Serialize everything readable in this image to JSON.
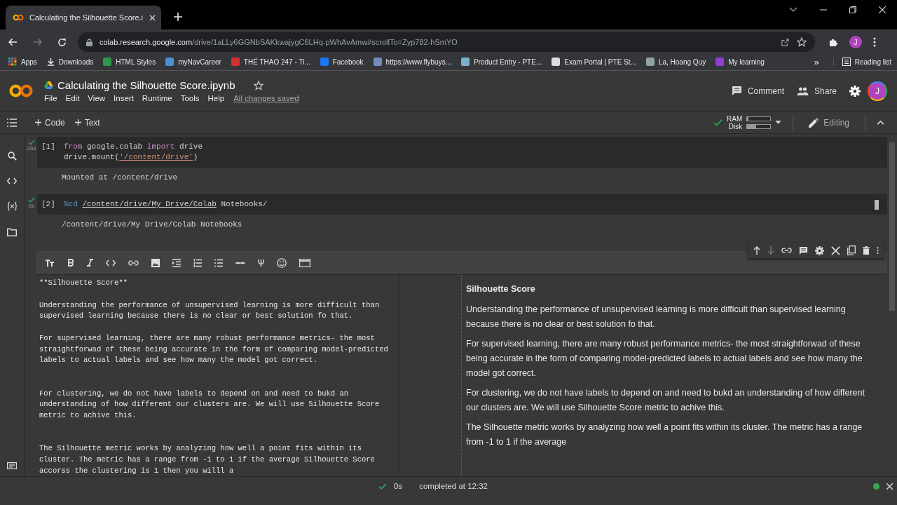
{
  "browser": {
    "tabs": [
      {
        "title": "Calculating the Silhouette Score.i",
        "selected": true
      }
    ],
    "url": {
      "host": "colab.research.google.com",
      "path": "/drive/1aLLy6GGNbSAKkwajygC6LHq-pWhAvAmw#scrollTo=Zyp782-hSmYO"
    },
    "profile_initial": "J",
    "bookmarks": [
      {
        "label": "Apps",
        "kind": "apps"
      },
      {
        "label": "Downloads",
        "kind": "download"
      },
      {
        "label": "HTML Styles",
        "kind": "site",
        "color": "#2e9b4a"
      },
      {
        "label": "myNavCareer",
        "kind": "site",
        "color": "#4a8fd6"
      },
      {
        "label": "THỂ THAO 247 - Ti...",
        "kind": "site",
        "color": "#d32f2f"
      },
      {
        "label": "Facebook",
        "kind": "site",
        "color": "#1877f2"
      },
      {
        "label": "https://www.flybuys...",
        "kind": "site",
        "color": "#6f8fb5"
      },
      {
        "label": "Product Entry - PTE...",
        "kind": "site",
        "color": "#7ab3c9"
      },
      {
        "label": "Exam Portal | PTE St...",
        "kind": "site",
        "color": "#dddddd"
      },
      {
        "label": "La, Hoang Quy",
        "kind": "site",
        "color": "#8fa3a0"
      },
      {
        "label": "My learning",
        "kind": "site",
        "color": "#8e3fd0"
      }
    ],
    "bookmarks_overflow": "»",
    "reading_list": "Reading list"
  },
  "notebook": {
    "title": "Calculating the Silhouette Score.ipynb",
    "starred": false,
    "menu": [
      "File",
      "Edit",
      "View",
      "Insert",
      "Runtime",
      "Tools",
      "Help"
    ],
    "save_status": "All changes saved",
    "comment": "Comment",
    "share": "Share",
    "user_initial": "J",
    "add_buttons": [
      "Code",
      "Text"
    ],
    "connected": true,
    "resources": [
      {
        "label": "RAM",
        "level": 0.05
      },
      {
        "label": "Disk",
        "level": 0.4
      }
    ],
    "mode": "Editing"
  },
  "cells": [
    {
      "kind": "code",
      "count": "[1]",
      "done": true,
      "time": "26s",
      "lines": [
        [
          {
            "kind": "keyword",
            "text": "from"
          },
          {
            "kind": "plain",
            "text": " google.colab "
          },
          {
            "kind": "keyword",
            "text": "import"
          },
          {
            "kind": "plain",
            "text": " drive"
          }
        ],
        [
          {
            "kind": "plain",
            "text": "drive.mount("
          },
          {
            "kind": "string",
            "text": "'/content/drive'"
          },
          {
            "kind": "plain",
            "text": ")"
          }
        ]
      ],
      "output": "Mounted at /content/drive"
    },
    {
      "kind": "code",
      "count": "[2]",
      "done": true,
      "time": "0s",
      "lines": [
        [
          {
            "kind": "magic",
            "text": "%cd "
          },
          {
            "kind": "path",
            "text": "/content/drive/My Drive/Colab"
          },
          {
            "kind": "plain",
            "text": " Notebooks/"
          }
        ]
      ],
      "output": "/content/drive/My Drive/Colab Notebooks"
    },
    {
      "kind": "text",
      "source": [
        {
          "kind": "line",
          "text": "**Silhouette Score**"
        },
        {
          "kind": "blank"
        },
        {
          "kind": "line",
          "text": "Understanding the performance of unsupervised learning is more difficult than"
        },
        {
          "kind": "line",
          "text": "supervised learning because there is no clear or best solution fo that."
        },
        {
          "kind": "blank"
        },
        {
          "kind": "line",
          "text": "For supervised learning, there are many robust performance metrics- the most"
        },
        {
          "kind": "line",
          "text": "straightforwad of these being accurate in the form of comparing model-predicted"
        },
        {
          "kind": "line",
          "text": "labels to actual labels and see how many the model got correct."
        },
        {
          "kind": "blank"
        },
        {
          "kind": "blank"
        },
        {
          "kind": "line",
          "text": "For clustering, we do not have labels to depend on and need to bukd an"
        },
        {
          "kind": "line",
          "text": "understanding of how different our clusters are. We will use Silhouette Score"
        },
        {
          "kind": "line",
          "text": "metric to achive this."
        },
        {
          "kind": "blank"
        },
        {
          "kind": "blank"
        },
        {
          "kind": "line",
          "text": "The Silhouette metric works by analyzing how well a point fits within its"
        },
        {
          "kind": "line",
          "text": "cluster. The metric has a range from -1 to 1 if the average Silhouette Score"
        },
        {
          "kind": "line",
          "text": "accorss the clustering is 1 then you willl a"
        }
      ],
      "preview": [
        {
          "kind": "heading",
          "text": "Silhouette Score"
        },
        {
          "kind": "paragraph",
          "text": "Understanding the performance of unsupervised learning is more difficult than supervised learning because there is no clear or best solution fo that."
        },
        {
          "kind": "paragraph",
          "text": "For supervised learning, there are many robust performance metrics- the most straightforwad of these being accurate in the form of comparing model-predicted labels to actual labels and see how many the model got correct."
        },
        {
          "kind": "paragraph",
          "text": "For clustering, we do not have labels to depend on and need to bukd an understanding of how different our clusters are. We will use Silhouette Score metric to achive this."
        },
        {
          "kind": "paragraph",
          "text": "The Silhouette metric works by analyzing how well a point fits within its cluster. The metric has a range from -1 to 1 if the average"
        }
      ]
    }
  ],
  "status": {
    "done": true,
    "duration": "0s",
    "message": "completed at 12:32",
    "connected": true
  }
}
